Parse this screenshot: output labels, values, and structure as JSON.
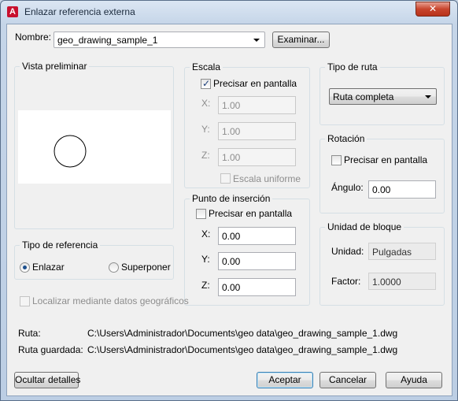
{
  "window": {
    "title": "Enlazar referencia externa",
    "close_glyph": "✕",
    "app_icon_letter": "A"
  },
  "name": {
    "label": "Nombre:",
    "value": "geo_drawing_sample_1",
    "browse_label": "Examinar..."
  },
  "preview": {
    "title": "Vista preliminar"
  },
  "scale": {
    "title": "Escala",
    "specify_label": "Precisar en pantalla",
    "specify_checked": true,
    "x_label": "X:",
    "x_value": "1.00",
    "y_label": "Y:",
    "y_value": "1.00",
    "z_label": "Z:",
    "z_value": "1.00",
    "uniform_label": "Escala uniforme"
  },
  "insertion": {
    "title": "Punto de inserción",
    "specify_label": "Precisar en pantalla",
    "x_label": "X:",
    "x_value": "0.00",
    "y_label": "Y:",
    "y_value": "0.00",
    "z_label": "Z:",
    "z_value": "0.00"
  },
  "path_type": {
    "title": "Tipo de ruta",
    "value": "Ruta completa"
  },
  "rotation": {
    "title": "Rotación",
    "specify_label": "Precisar en pantalla",
    "angle_label": "Ángulo:",
    "angle_value": "0.00"
  },
  "block_unit": {
    "title": "Unidad de bloque",
    "unit_label": "Unidad:",
    "unit_value": "Pulgadas",
    "factor_label": "Factor:",
    "factor_value": "1.0000"
  },
  "reference_type": {
    "title": "Tipo de referencia",
    "attach_label": "Enlazar",
    "overlay_label": "Superponer",
    "selected": "Enlazar"
  },
  "geo": {
    "label": "Localizar mediante datos geográficos"
  },
  "paths": {
    "found_label": "Ruta:",
    "found_value": "C:\\Users\\Administrador\\Documents\\geo data\\geo_drawing_sample_1.dwg",
    "saved_label": "Ruta guardada:",
    "saved_value": "C:\\Users\\Administrador\\Documents\\geo data\\geo_drawing_sample_1.dwg"
  },
  "buttons": {
    "hide_details": "Ocultar detalles",
    "ok": "Aceptar",
    "cancel": "Cancelar",
    "help": "Ayuda"
  },
  "colors": {
    "accent_blue": "#3c7fb1",
    "close_red": "#c8452d",
    "dialog_bg": "#f0f0f0"
  }
}
